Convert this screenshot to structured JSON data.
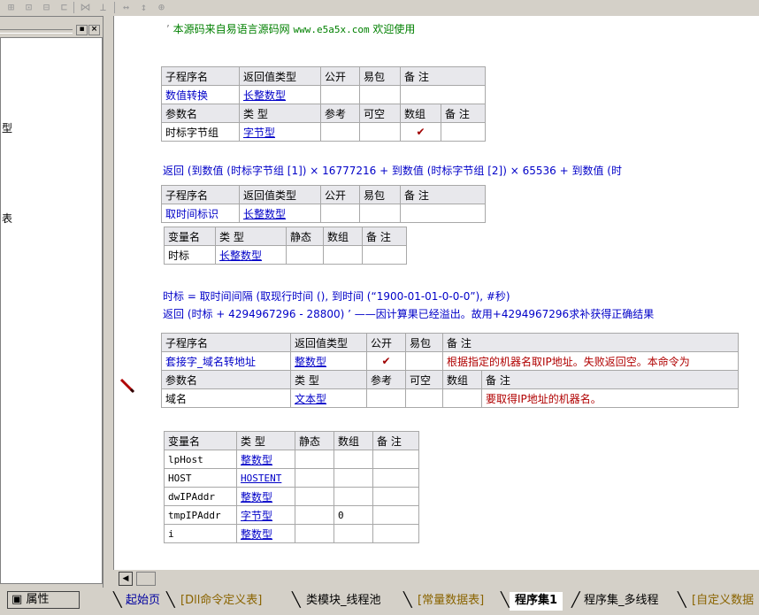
{
  "toolbar": {
    "icons": [
      "align-grid-icon",
      "align-top-icon",
      "align-middle-icon",
      "align-right-icon",
      "distribute-h-icon",
      "distribute-v-icon",
      "same-width-icon",
      "same-height-icon",
      "same-size-icon"
    ]
  },
  "left_panel": {
    "min_btn": "▪",
    "close_btn": "×",
    "fragment_1": "型",
    "fragment_2": "表"
  },
  "comment_line": {
    "prefix": "’ ",
    "text_cn": "本源码来自易语言源码网",
    "url": "www.e5a5x.com",
    "suffix": "欢迎使用"
  },
  "sub1": {
    "header": [
      "子程序名",
      "返回值类型",
      "公开",
      "易包",
      "备 注"
    ],
    "row": [
      "数值转换",
      "长整数型",
      "",
      "",
      ""
    ],
    "param_header": [
      "参数名",
      "类 型",
      "参考",
      "可空",
      "数组",
      "备 注"
    ],
    "param_row": [
      "时标字节组",
      "字节型",
      "",
      "",
      "✔",
      ""
    ],
    "code": "返回 (到数值 (时标字节组 [1]) × 16777216 + 到数值 (时标字节组 [2]) × 65536 + 到数值 (时"
  },
  "sub2": {
    "header": [
      "子程序名",
      "返回值类型",
      "公开",
      "易包",
      "备 注"
    ],
    "row": [
      "取时间标识",
      "长整数型",
      "",
      "",
      ""
    ],
    "var_header": [
      "变量名",
      "类 型",
      "静态",
      "数组",
      "备 注"
    ],
    "var_row": [
      "时标",
      "长整数型",
      "",
      "",
      ""
    ],
    "code1": "时标 = 取时间间隔 (取现行时间 (), 到时间 (“1900-01-01-0-0-0”), #秒)",
    "code2": "返回 (时标 + 4294967296 - 28800) ’ ——因计算果已经溢出。故用+4294967296求补获得正确结果"
  },
  "sub3": {
    "header": [
      "子程序名",
      "返回值类型",
      "公开",
      "易包",
      "备 注"
    ],
    "row": [
      "套接字_域名转地址",
      "整数型",
      "✔",
      "",
      "根据指定的机器名取IP地址。失败返回空。本命令为"
    ],
    "param_header": [
      "参数名",
      "类 型",
      "参考",
      "可空",
      "数组",
      "备 注"
    ],
    "param_row": [
      "域名",
      "文本型",
      "",
      "",
      "",
      "要取得IP地址的机器名。"
    ],
    "var_header": [
      "变量名",
      "类 型",
      "静态",
      "数组",
      "备 注"
    ],
    "var_rows": [
      [
        "lpHost",
        "整数型",
        "",
        "",
        ""
      ],
      [
        "HOST",
        "HOSTENT",
        "",
        "",
        ""
      ],
      [
        "dwIPAddr",
        "整数型",
        "",
        "",
        ""
      ],
      [
        "tmpIPAddr",
        "字节型",
        "",
        "0",
        ""
      ],
      [
        "i",
        "整数型",
        "",
        "",
        ""
      ]
    ]
  },
  "bottom": {
    "prop_label": "属性",
    "tabs": [
      "起始页",
      "[Dll命令定义表]",
      "类模块_线程池",
      "[常量数据表]",
      "程序集1",
      "程序集_多线程",
      "[自定义数据"
    ],
    "active_tab": "程序集1"
  },
  "colors": {
    "panel": "#d4d0c8",
    "keyword_blue": "#0000c8",
    "func_red": "#b00000",
    "header_bg": "#e8e8ec"
  }
}
